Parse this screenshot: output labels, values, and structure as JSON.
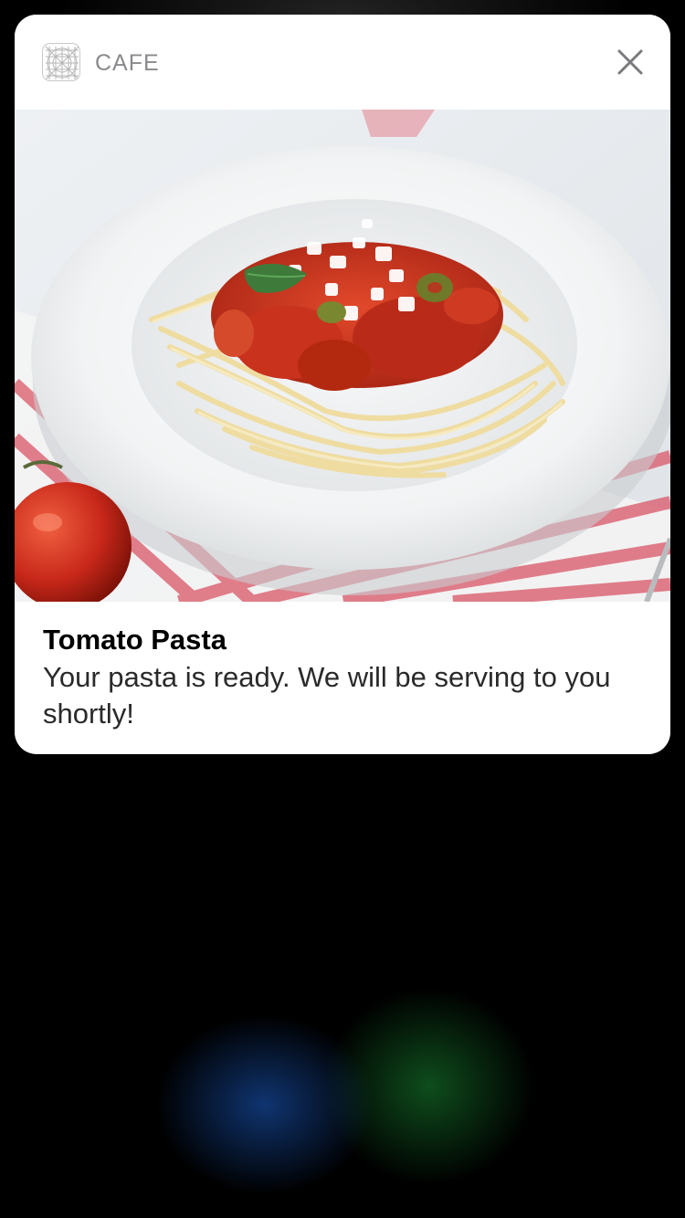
{
  "notification": {
    "app_name": "CAFE",
    "app_icon": "cafe-grid-icon",
    "close_icon": "close-icon",
    "media": {
      "subject": "pasta-plate-photo",
      "description_icons": [
        "plate",
        "spaghetti",
        "tomato-sauce",
        "basil-leaf",
        "olive",
        "tomato",
        "striped-napkin"
      ]
    },
    "title": "Tomato Pasta",
    "message": "Your pasta is ready. We will be serving to you shortly!"
  },
  "colors": {
    "card_background": "#ffffff",
    "app_name_color": "#8a8a8e",
    "title_color": "#000000",
    "message_color": "#2a2a2a",
    "screen_background": "#000000",
    "sauce_red": "#c9321d",
    "pasta_yellow": "#f1e3b0",
    "napkin_red": "#d9485a"
  }
}
